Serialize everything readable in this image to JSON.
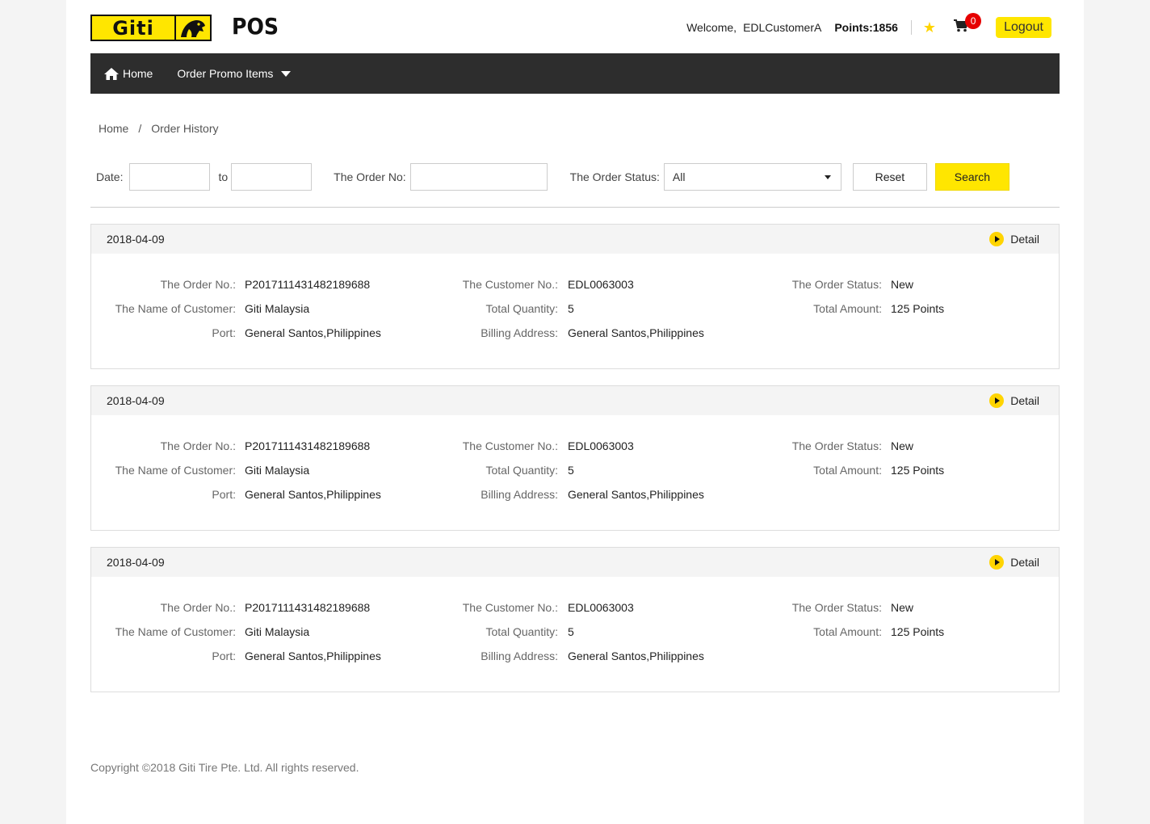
{
  "header": {
    "logo_text": "Giti",
    "app_title": "POS",
    "welcome": "Welcome,",
    "username": "EDLCustomerA",
    "points": "Points:1856",
    "cart_count": "0",
    "logout_label": "Logout"
  },
  "nav": {
    "home_label": "Home",
    "promo_label": "Order Promo Items"
  },
  "breadcrumb": {
    "home": "Home",
    "separator": "/",
    "current": "Order History"
  },
  "filters": {
    "date_label": "Date:",
    "to_label": "to",
    "date_from": "",
    "date_to": "",
    "order_no_label": "The Order No:",
    "order_no_value": "",
    "status_label": "The Order Status:",
    "status_selected": "All",
    "reset_label": "Reset",
    "search_label": "Search"
  },
  "order_labels": {
    "order_no": "The Order No.:",
    "customer_no": "The Customer No.:",
    "order_status": "The Order Status:",
    "customer_name": "The Name of Customer:",
    "total_quantity": "Total Quantity:",
    "total_amount": "Total Amount:",
    "port": "Port:",
    "billing_address": "Billing Address:",
    "detail": "Detail"
  },
  "orders": [
    {
      "date": "2018-04-09",
      "order_no": "P2017111431482189688",
      "customer_no": "EDL0063003",
      "order_status": "New",
      "customer_name": "Giti Malaysia",
      "total_quantity": "5",
      "total_amount": "125 Points",
      "port": "General Santos,Philippines",
      "billing_address": "General Santos,Philippines"
    },
    {
      "date": "2018-04-09",
      "order_no": "P2017111431482189688",
      "customer_no": "EDL0063003",
      "order_status": "New",
      "customer_name": "Giti Malaysia",
      "total_quantity": "5",
      "total_amount": "125 Points",
      "port": "General Santos,Philippines",
      "billing_address": "General Santos,Philippines"
    },
    {
      "date": "2018-04-09",
      "order_no": "P2017111431482189688",
      "customer_no": "EDL0063003",
      "order_status": "New",
      "customer_name": "Giti Malaysia",
      "total_quantity": "5",
      "total_amount": "125 Points",
      "port": "General Santos,Philippines",
      "billing_address": "General Santos,Philippines"
    }
  ],
  "footer": {
    "copyright": "Copyright ©2018 Giti Tire Pte. Ltd. All rights reserved."
  },
  "colors": {
    "brand_yellow": "#ffe600",
    "nav_bg": "#2d2d2d",
    "badge_red": "#e60000"
  },
  "icons": {
    "home": "home-icon",
    "caret": "chevron-down-icon",
    "star": "star-icon",
    "cart": "cart-icon",
    "detail": "play-circle-icon"
  }
}
